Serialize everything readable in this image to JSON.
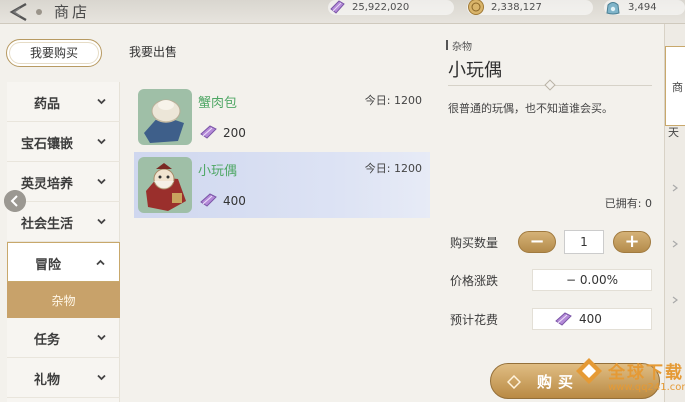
{
  "header": {
    "title": "商店",
    "currencies": [
      {
        "icon": "crystal-icon",
        "value": "25,922,020"
      },
      {
        "icon": "coin-icon",
        "value": "2,338,127"
      },
      {
        "icon": "gem-bag-icon",
        "value": "3,494"
      }
    ]
  },
  "tabs": {
    "buy": "我要购买",
    "sell": "我要出售",
    "active": "buy"
  },
  "nav": {
    "items": [
      {
        "label": "药品"
      },
      {
        "label": "宝石镶嵌"
      },
      {
        "label": "英灵培养"
      },
      {
        "label": "社会生活"
      },
      {
        "label": "冒险",
        "expanded": true
      },
      {
        "label": "任务"
      },
      {
        "label": "礼物"
      }
    ],
    "sub_item": "杂物"
  },
  "items": [
    {
      "name": "蟹肉包",
      "limit": "今日: 1200",
      "price": "200",
      "selected": false
    },
    {
      "name": "小玩偶",
      "limit": "今日: 1200",
      "price": "400",
      "selected": true
    }
  ],
  "detail": {
    "category": "杂物",
    "name": "小玩偶",
    "description": "很普通的玩偶，也不知道谁会买。",
    "owned": "已拥有: 0",
    "quantity_label": "购买数量",
    "quantity": "1",
    "minus": "−",
    "plus": "+",
    "price_change_label": "价格涨跌",
    "price_change": "− 0.00%",
    "cost_label": "预计花费",
    "cost": "400"
  },
  "buy_button": "购买",
  "right_tabs": [
    "商",
    "天"
  ],
  "watermark": {
    "text": "全球下载",
    "url": "www.qq241.com"
  },
  "colors": {
    "accent_gold": "#c8a26a",
    "item_name_green": "#4fa765",
    "selected_row": "#d6ddf1"
  }
}
